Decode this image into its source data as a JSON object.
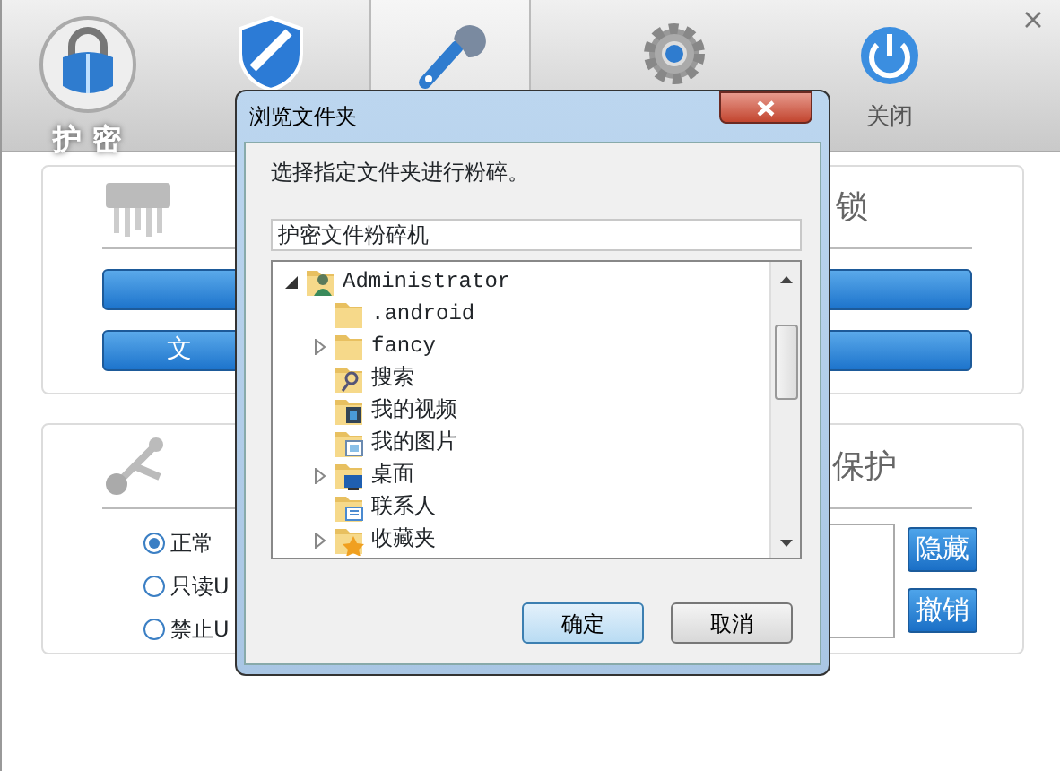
{
  "app_logo": {
    "label": "护 密"
  },
  "tabs": [
    {
      "selected": false
    },
    {
      "selected": true
    },
    {
      "selected": false
    },
    {
      "label": "关闭",
      "selected": false
    }
  ],
  "panels": [
    {
      "heading": "锁",
      "bars": [
        {
          "kind": "plain"
        },
        {
          "kind": "labeled",
          "label": "文"
        }
      ]
    },
    {
      "heading": "保护",
      "options": [
        {
          "label": "正常",
          "selected": true
        },
        {
          "label": "只读U",
          "selected": false
        },
        {
          "label": "禁止U",
          "selected": false
        }
      ],
      "actions": [
        "隐藏",
        "撤销"
      ]
    }
  ],
  "dialog": {
    "title": "浏览文件夹",
    "prompt": "选择指定文件夹进行粉碎。",
    "folder_name": "护密文件粉碎机",
    "tree": [
      {
        "label": "Administrator",
        "kind": "user",
        "expanded": true,
        "children": [
          {
            "label": ".android",
            "kind": "folder"
          },
          {
            "label": "fancy",
            "kind": "folder",
            "expanded": false
          },
          {
            "label": "搜索",
            "kind": "search"
          },
          {
            "label": "我的视频",
            "kind": "video"
          },
          {
            "label": "我的图片",
            "kind": "pictures"
          },
          {
            "label": "桌面",
            "kind": "desktop",
            "expanded": false
          },
          {
            "label": "联系人",
            "kind": "contacts"
          },
          {
            "label": "收藏夹",
            "kind": "favorites",
            "expanded": false
          }
        ]
      }
    ],
    "buttons": [
      {
        "label": "确定",
        "kind": "default"
      },
      {
        "label": "取消",
        "kind": "normal"
      }
    ]
  }
}
